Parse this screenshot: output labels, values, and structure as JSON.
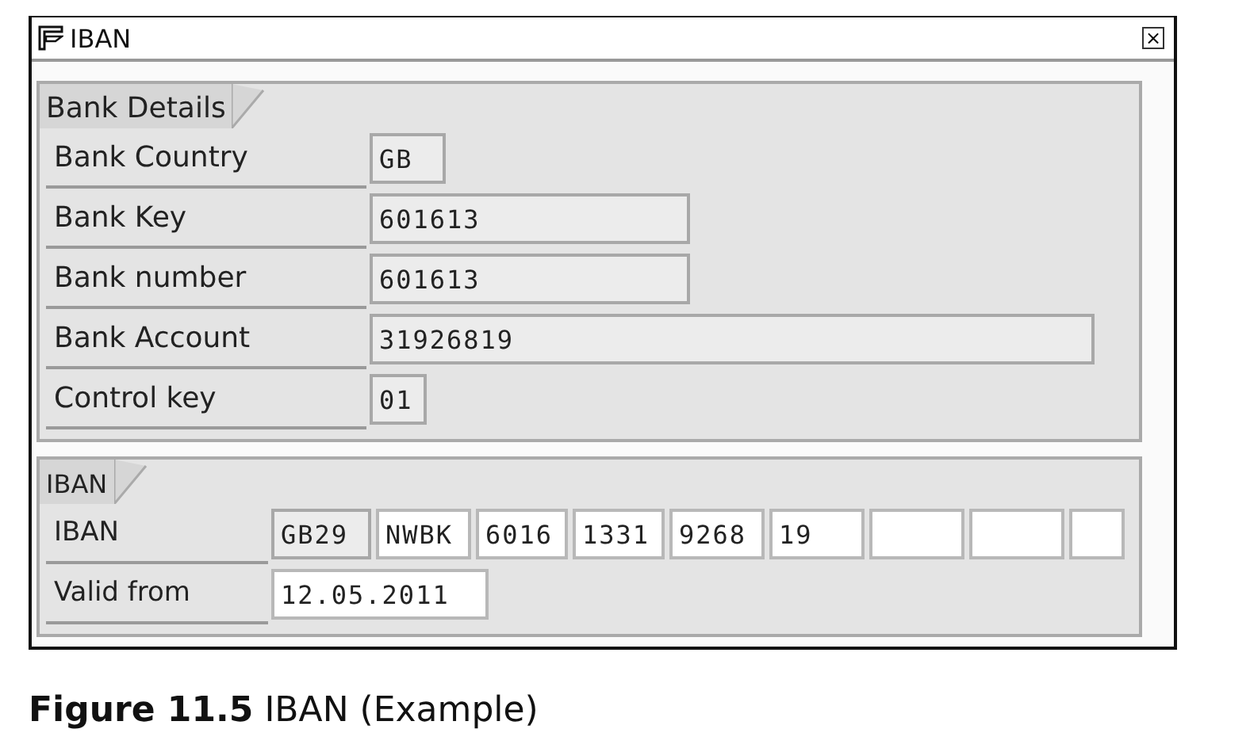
{
  "window": {
    "title": "IBAN",
    "close": "×"
  },
  "groups": [
    {
      "title": "Bank Details",
      "rows": [
        {
          "label": "Bank Country",
          "fields": [
            {
              "value": "GB",
              "editable": false
            }
          ]
        },
        {
          "label": "Bank Key",
          "fields": [
            {
              "value": "601613",
              "editable": false
            }
          ]
        },
        {
          "label": "Bank number",
          "fields": [
            {
              "value": "601613",
              "editable": false
            }
          ]
        },
        {
          "label": "Bank Account",
          "fields": [
            {
              "value": "31926819",
              "editable": false
            }
          ]
        },
        {
          "label": "Control key",
          "fields": [
            {
              "value": "01",
              "editable": false
            }
          ]
        }
      ]
    },
    {
      "title": "IBAN",
      "rows": [
        {
          "label": "IBAN",
          "fields": [
            {
              "value": "GB29",
              "editable": false
            },
            {
              "value": "NWBK",
              "editable": true
            },
            {
              "value": "6016",
              "editable": true
            },
            {
              "value": "1331",
              "editable": true
            },
            {
              "value": "9268",
              "editable": true
            },
            {
              "value": "19",
              "editable": true
            },
            {
              "editable": true
            },
            {
              "editable": true
            },
            {
              "editable": true
            }
          ]
        },
        {
          "label": "Valid from",
          "fields": [
            {
              "value": "12.05.2011",
              "editable": true
            }
          ]
        }
      ]
    }
  ],
  "caption": "**Figure 11.5**  IBAN (Example)"
}
